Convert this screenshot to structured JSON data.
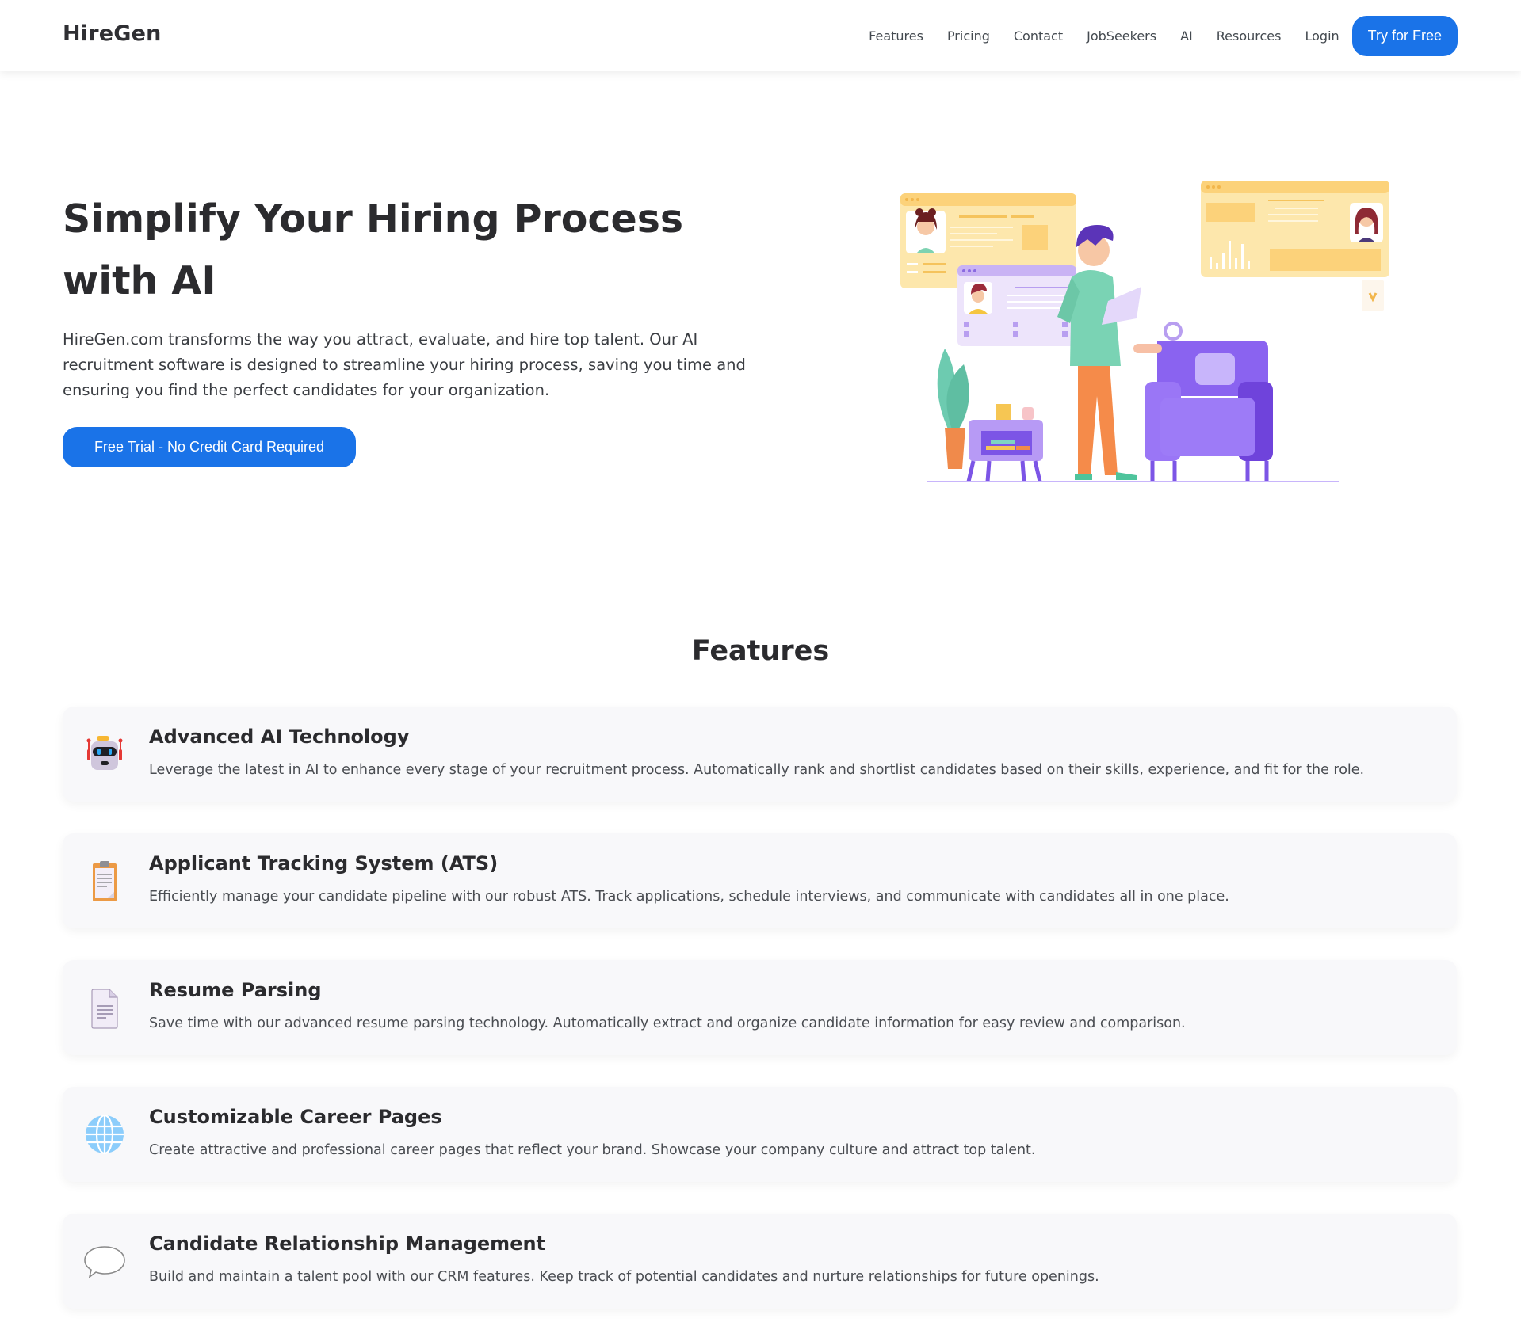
{
  "nav": {
    "logo": "HireGen",
    "links": [
      "Features",
      "Pricing",
      "Contact",
      "JobSeekers",
      "AI",
      "Resources",
      "Login"
    ],
    "cta_label": "Try for Free"
  },
  "hero": {
    "title": "Simplify Your Hiring Process with AI",
    "description": "HireGen.com transforms the way you attract, evaluate, and hire top talent. Our AI recruitment software is designed to streamline your hiring process, saving you time and ensuring you find the perfect candidates for your organization.",
    "cta_label": "Free Trial - No Credit Card Required",
    "illustration": "person-reviewing-candidate-profiles-illustration"
  },
  "features": {
    "title": "Features",
    "items": [
      {
        "icon": "robot-icon",
        "title": "Advanced AI Technology",
        "description": "Leverage the latest in AI to enhance every stage of your recruitment process. Automatically rank and shortlist candidates based on their skills, experience, and fit for the role."
      },
      {
        "icon": "clipboard-icon",
        "title": "Applicant Tracking System (ATS)",
        "description": "Efficiently manage your candidate pipeline with our robust ATS. Track applications, schedule interviews, and communicate with candidates all in one place."
      },
      {
        "icon": "document-icon",
        "title": "Resume Parsing",
        "description": "Save time with our advanced resume parsing technology. Automatically extract and organize candidate information for easy review and comparison."
      },
      {
        "icon": "globe-icon",
        "title": "Customizable Career Pages",
        "description": "Create attractive and professional career pages that reflect your brand. Showcase your company culture and attract top talent."
      },
      {
        "icon": "speech-bubble-icon",
        "title": "Candidate Relationship Management",
        "description": "Build and maintain a talent pool with our CRM features. Keep track of potential candidates and nurture relationships for future openings."
      }
    ]
  },
  "colors": {
    "primary": "#1a73e8",
    "heading": "#2b2b2e",
    "body_text": "#3a3d42",
    "card_bg": "#f8f8fa"
  }
}
